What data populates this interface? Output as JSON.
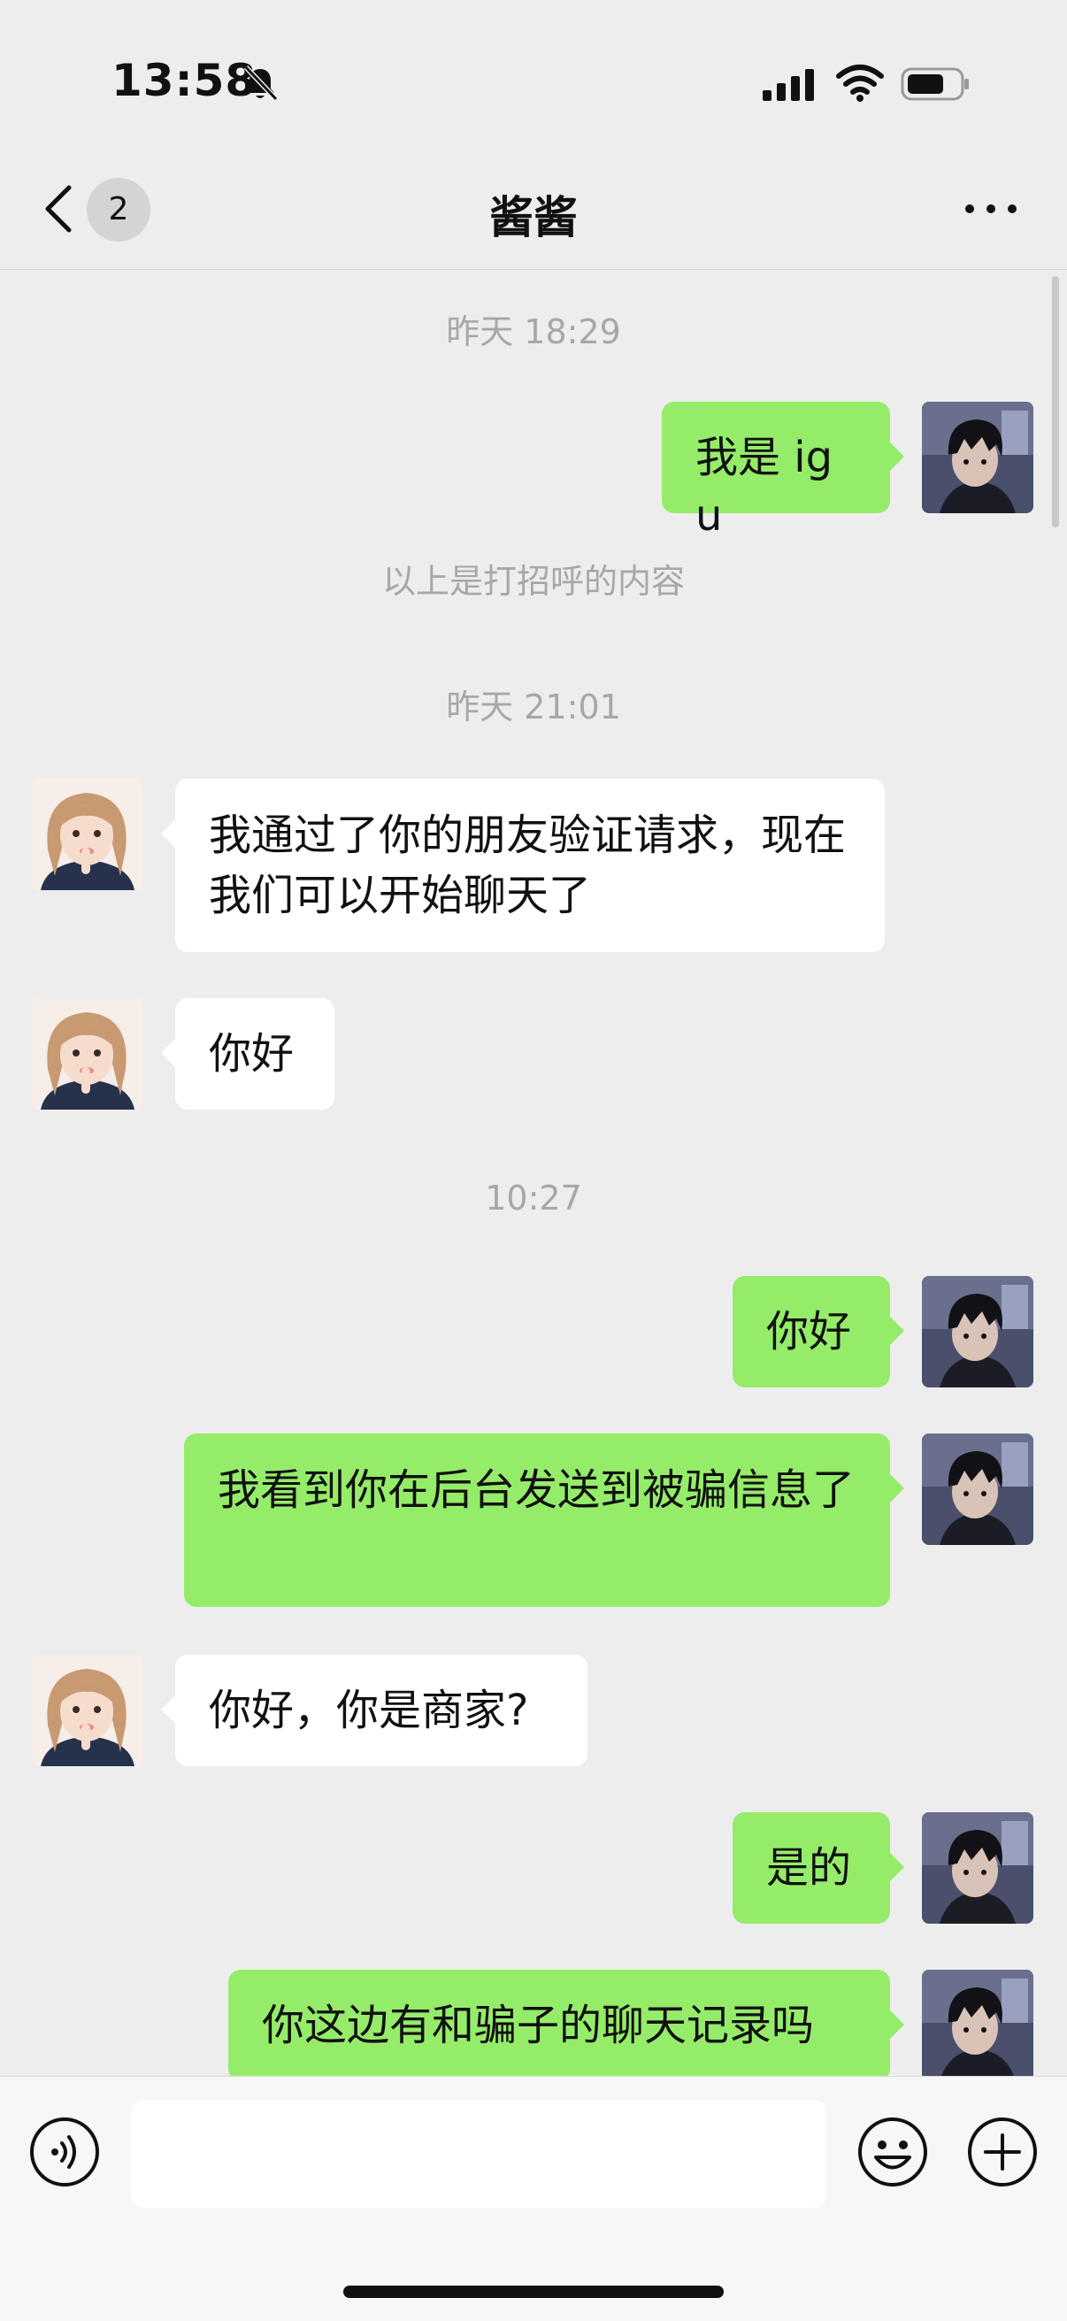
{
  "status_bar": {
    "time": "13:58",
    "icons": [
      "bell-muted-icon",
      "signal-icon",
      "wifi-icon",
      "battery-icon"
    ]
  },
  "header": {
    "back_icon": "chevron-left-icon",
    "unread_count": "2",
    "title": "酱酱",
    "more_icon": "ellipsis-icon"
  },
  "messages": {
    "ts1": "昨天 18:29",
    "m1": "我是 igu",
    "note": "以上是打招呼的内容",
    "ts2": "昨天 21:01",
    "m2": "我通过了你的朋友验证请求，现在我们可以开始聊天了",
    "m3": "你好",
    "ts3": "10:27",
    "m4": "你好",
    "m5": "我看到你在后台发送到被骗信息了",
    "m6": "你好，你是商家?",
    "m7": "是的",
    "m8": "你这边有和骗子的聊天记录吗"
  },
  "input_bar": {
    "voice_icon": "voice-icon",
    "placeholder": "",
    "emoji_icon": "emoji-icon",
    "plus_icon": "plus-icon"
  },
  "colors": {
    "background": "#ededed",
    "outgoing_bubble": "#95ec69",
    "incoming_bubble": "#ffffff",
    "timestamp_text": "#a7a7a7"
  }
}
